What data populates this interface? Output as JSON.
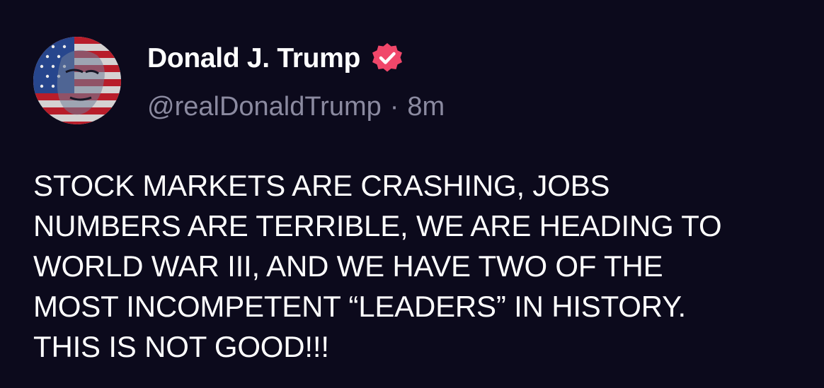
{
  "post": {
    "author": {
      "display_name": "Donald J. Trump",
      "handle": "@realDonaldTrump",
      "verified": true,
      "avatar_icon": "flag-portrait-avatar"
    },
    "separator": "·",
    "timestamp": "8m",
    "body_lines": [
      "STOCK MARKETS ARE CRASHING, JOBS",
      "NUMBERS ARE TERRIBLE, WE ARE HEADING TO",
      "WORLD WAR III, AND WE HAVE TWO OF THE",
      "MOST INCOMPETENT “LEADERS” IN HISTORY.",
      "THIS IS NOT GOOD!!!"
    ]
  },
  "colors": {
    "background": "#0c0a1c",
    "text_primary": "#ffffff",
    "text_secondary": "#8b8aa0",
    "verified_badge": "#f0476a"
  }
}
